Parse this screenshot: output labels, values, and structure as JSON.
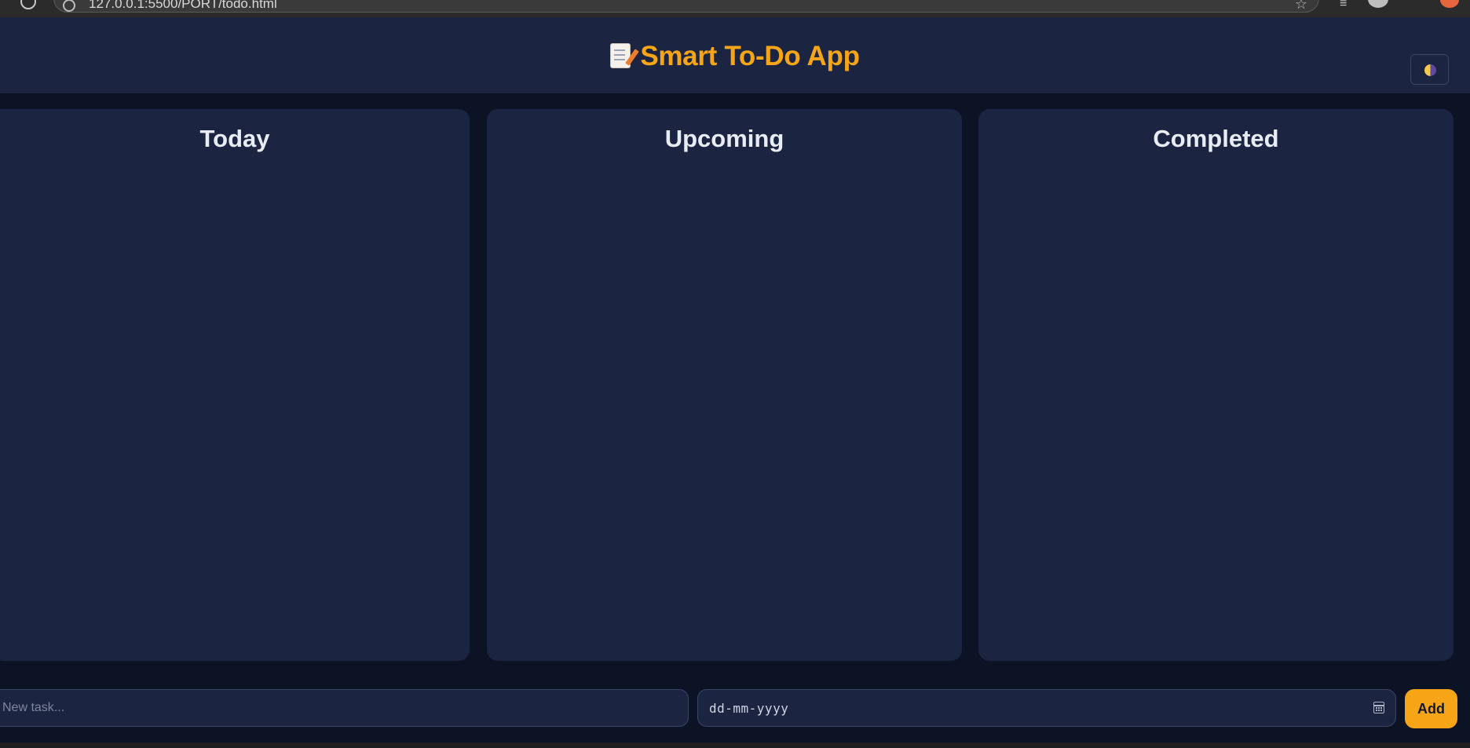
{
  "browser": {
    "url": "127.0.0.1:5500/PORT/todo.html"
  },
  "header": {
    "title": "Smart To-Do App",
    "title_icon": "memo-icon",
    "theme_toggle_icon": "half-moon-icon",
    "accent_color": "#f5a516"
  },
  "columns": [
    {
      "title": "Today"
    },
    {
      "title": "Upcoming"
    },
    {
      "title": "Completed"
    }
  ],
  "input_bar": {
    "task_placeholder": "New task...",
    "task_value": "",
    "date_value": "dd-mm-yyyy",
    "add_label": "Add"
  }
}
